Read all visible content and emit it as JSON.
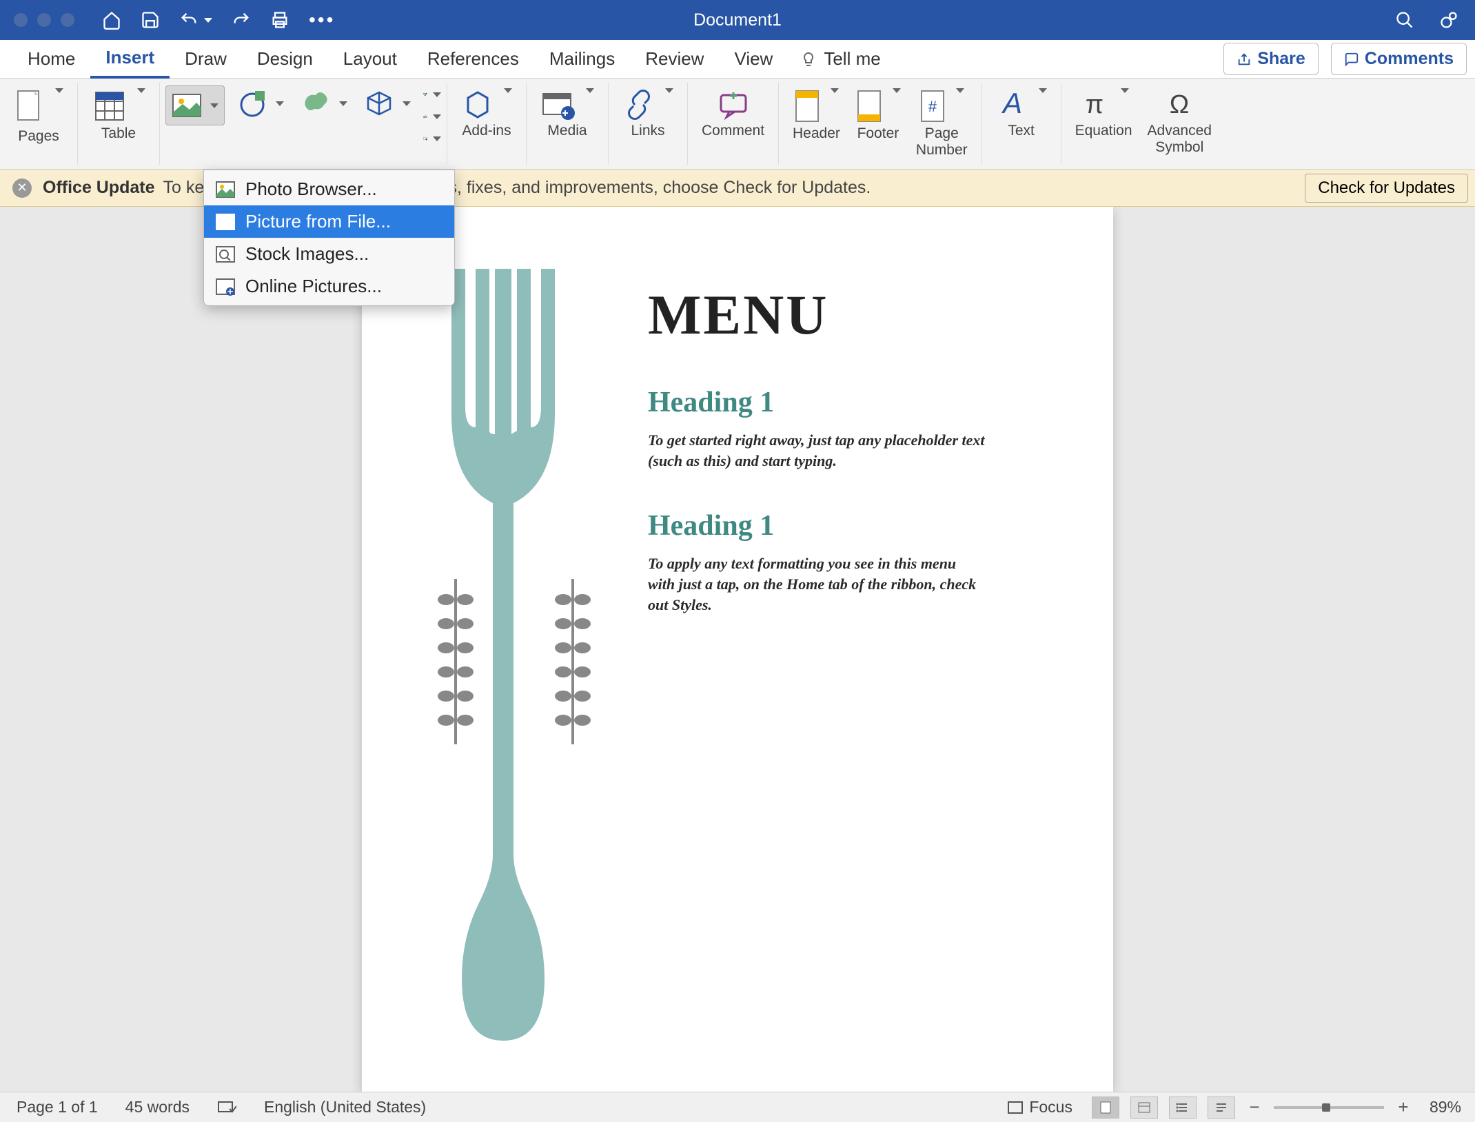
{
  "title_bar": {
    "doc_title": "Document1"
  },
  "menu_tabs": {
    "home": "Home",
    "insert": "Insert",
    "draw": "Draw",
    "design": "Design",
    "layout": "Layout",
    "references": "References",
    "mailings": "Mailings",
    "review": "Review",
    "view": "View",
    "tell_me": "Tell me"
  },
  "menu_right": {
    "share": "Share",
    "comments": "Comments"
  },
  "ribbon": {
    "pages": "Pages",
    "table": "Table",
    "addins": "Add-ins",
    "media": "Media",
    "links": "Links",
    "comment": "Comment",
    "header": "Header",
    "footer": "Footer",
    "page_number": "Page\nNumber",
    "text": "Text",
    "equation": "Equation",
    "advanced_symbol": "Advanced\nSymbol"
  },
  "pictures_dropdown": {
    "photo_browser": "Photo Browser...",
    "picture_from_file": "Picture from File...",
    "stock_images": "Stock Images...",
    "online_pictures": "Online Pictures..."
  },
  "notification": {
    "title": "Office Update",
    "text_fragment": "To ke                                              ates, fixes, and improvements, choose Check for Updates.",
    "button": "Check for Updates"
  },
  "document": {
    "title": "MENU",
    "heading1_a": "Heading 1",
    "para_a": "To get started right away, just tap any placeholder text (such as this) and start typing.",
    "heading1_b": "Heading 1",
    "para_b": "To apply any text formatting you see in this menu with just a tap, on the Home tab of the ribbon, check out Styles."
  },
  "status": {
    "page": "Page 1 of 1",
    "words": "45 words",
    "language": "English (United States)",
    "focus": "Focus",
    "zoom": "89%"
  }
}
